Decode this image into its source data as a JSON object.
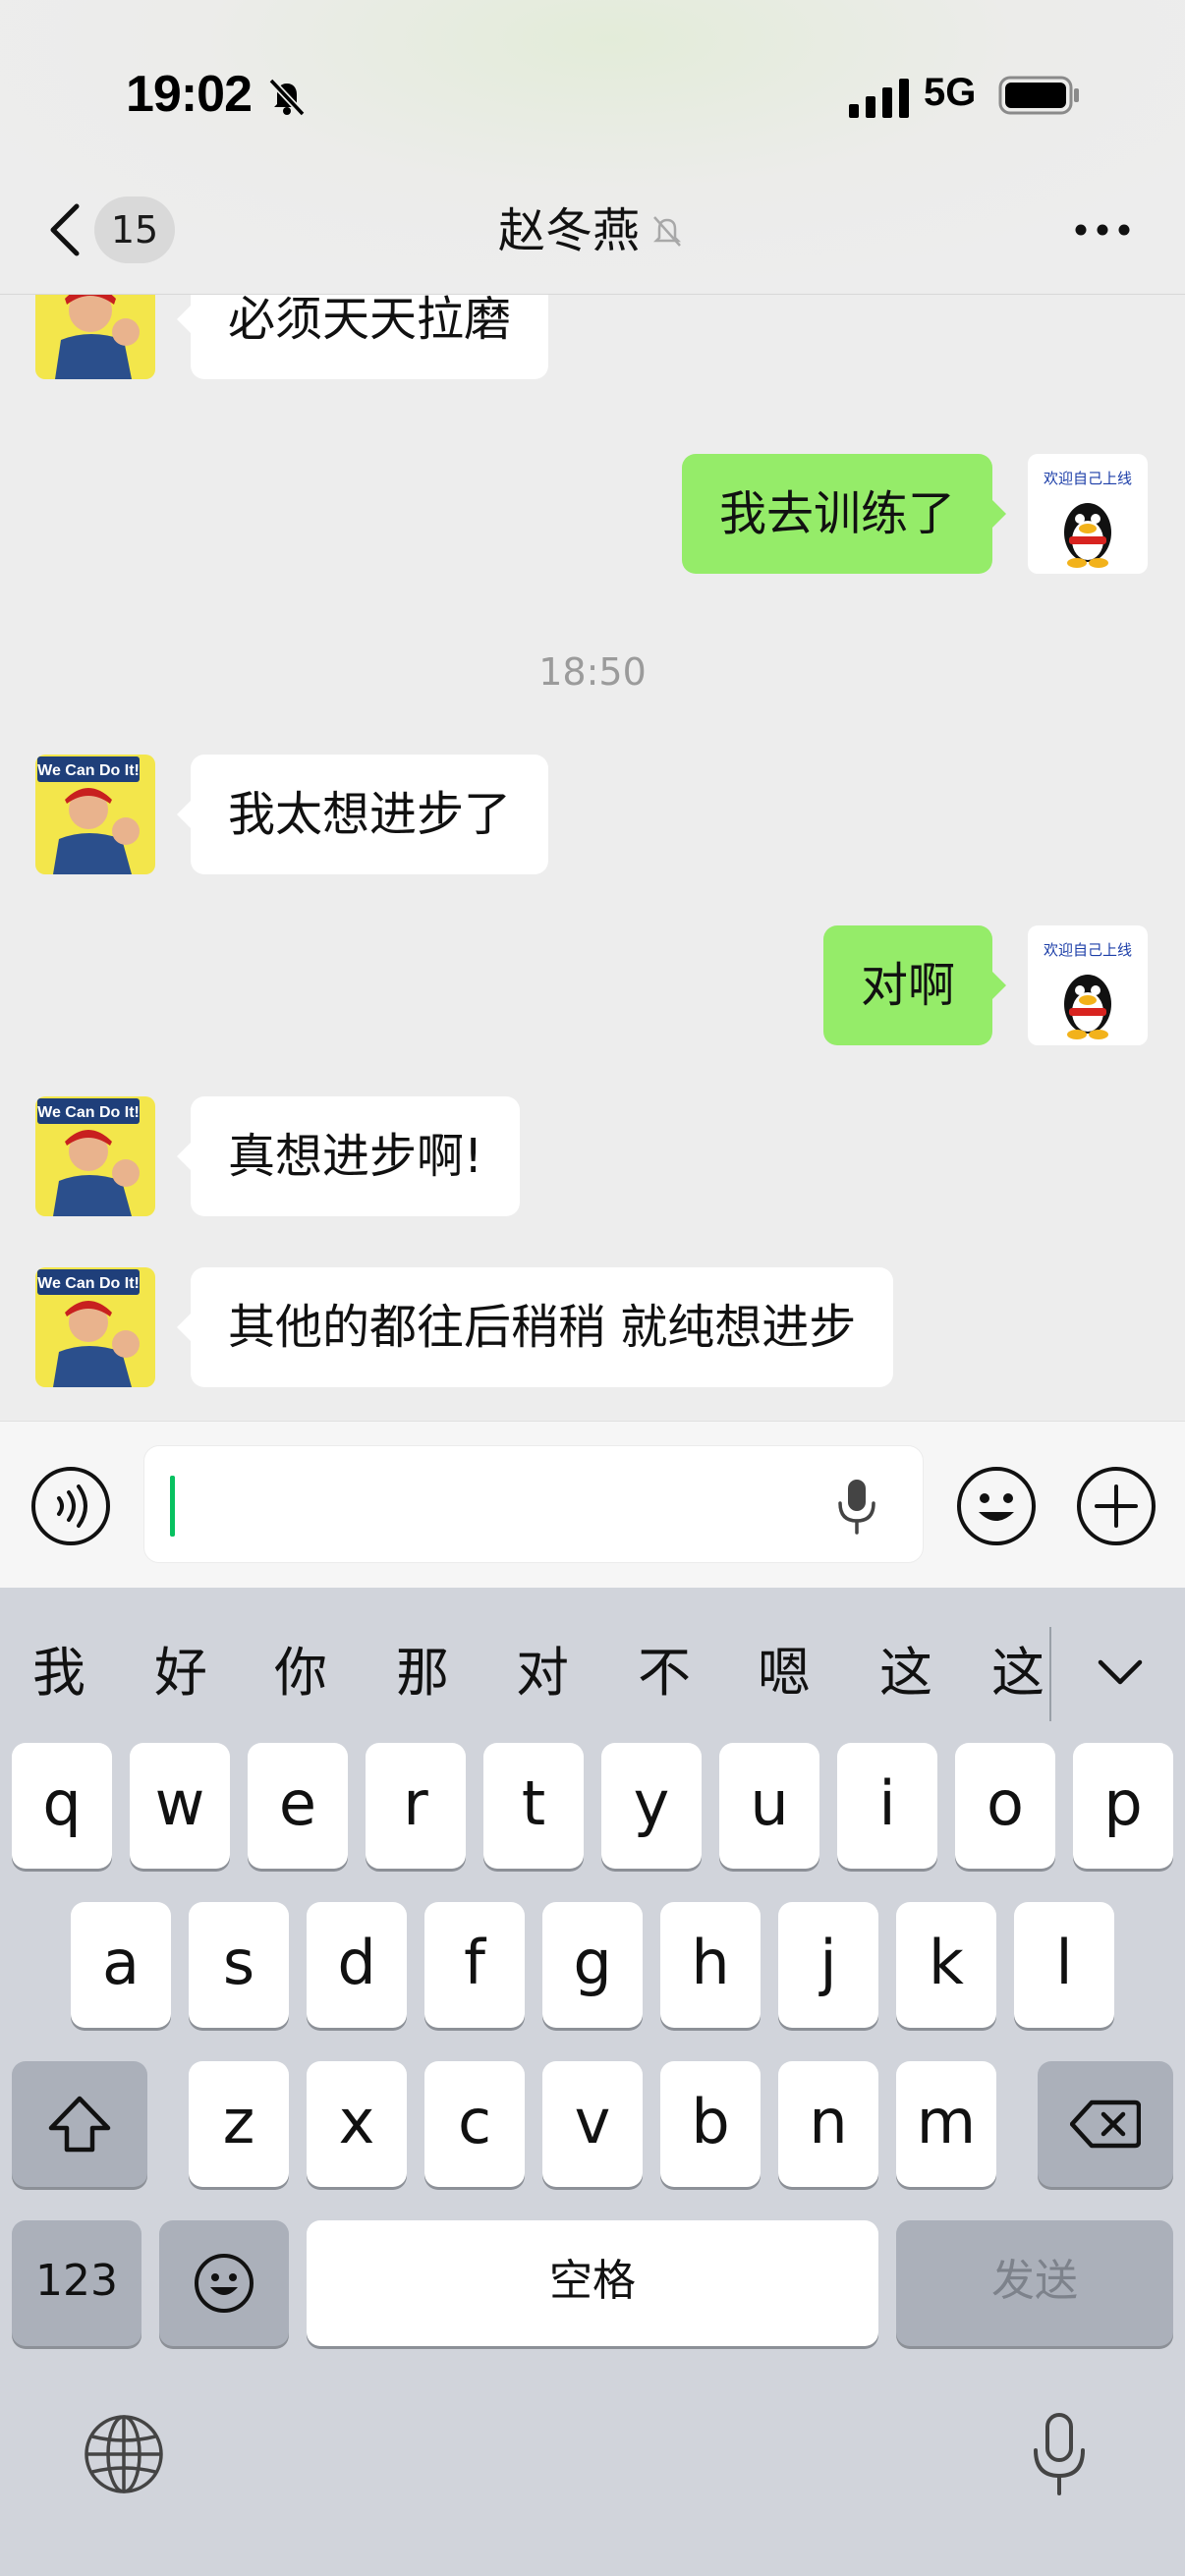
{
  "status_bar": {
    "time": "19:02",
    "network": "5G",
    "icons": [
      "bell-slash-icon",
      "signal-bars-icon",
      "battery-icon"
    ]
  },
  "nav": {
    "back_icon": "chevron-left-icon",
    "unread_count": "15",
    "title": "赵冬燕",
    "title_icon": "bell-slash-icon",
    "more_icon": "ellipsis-icon"
  },
  "messages": [
    {
      "side": "in",
      "text": "必须天天拉磨",
      "avatar": "we-can-do-it-poster"
    },
    {
      "side": "out",
      "text": "我去训练了",
      "avatar": "qq-penguin"
    },
    {
      "type": "time",
      "text": "18:50"
    },
    {
      "side": "in",
      "text": "我太想进步了",
      "avatar": "we-can-do-it-poster"
    },
    {
      "side": "out",
      "text": "对啊",
      "avatar": "qq-penguin"
    },
    {
      "side": "in",
      "text": "真想进步啊!",
      "avatar": "we-can-do-it-poster"
    },
    {
      "side": "in",
      "text": "其他的都往后稍稍 就纯想进步",
      "avatar": "we-can-do-it-poster"
    }
  ],
  "avatars": {
    "self_caption": "欢迎自己上线",
    "contact_caption": "We Can Do It!"
  },
  "input_bar": {
    "voice_icon": "voice-mode-icon",
    "input_value": "",
    "mic_icon": "microphone-icon",
    "emoji_icon": "smiley-icon",
    "plus_icon": "plus-circle-icon"
  },
  "keyboard": {
    "candidates": [
      "我",
      "好",
      "你",
      "那",
      "对",
      "不",
      "嗯",
      "这",
      "这"
    ],
    "row1": [
      "q",
      "w",
      "e",
      "r",
      "t",
      "y",
      "u",
      "i",
      "o",
      "p"
    ],
    "row2": [
      "a",
      "s",
      "d",
      "f",
      "g",
      "h",
      "j",
      "k",
      "l"
    ],
    "row3": [
      "z",
      "x",
      "c",
      "v",
      "b",
      "n",
      "m"
    ],
    "numbers_label": "123",
    "space_label": "空格",
    "send_label": "发送",
    "icons": [
      "shift-icon",
      "delete-icon",
      "emoji-key-icon",
      "globe-icon",
      "dictation-mic-icon",
      "chevron-down-icon"
    ]
  },
  "colors": {
    "outgoing_bubble": "#95ec69",
    "incoming_bubble": "#ffffff",
    "caret": "#07c160",
    "keyboard_bg": "#d1d4db"
  }
}
